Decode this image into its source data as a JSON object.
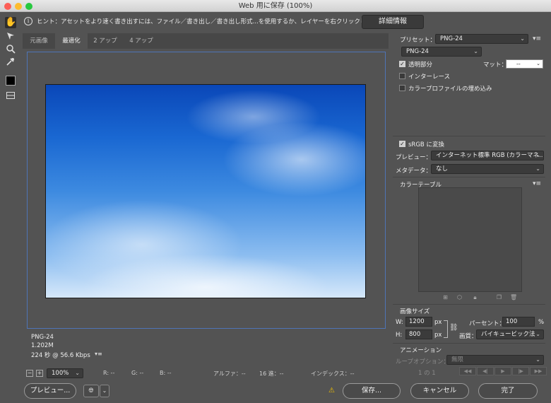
{
  "window": {
    "title": "Web 用に保存 (100%)"
  },
  "hint": {
    "text": "ヒント：アセットをより速く書き出すには、ファイル／書き出し／書き出し形式...を使用するか、レイヤーを右クリックして使用。",
    "details_button": "詳細情報"
  },
  "tools": [
    "hand-icon",
    "slice-select-icon",
    "zoom-icon",
    "eyedropper-icon",
    "color-swatch",
    "toggle-slices-icon"
  ],
  "tabs": [
    {
      "label": "元画像"
    },
    {
      "label": "最適化"
    },
    {
      "label": "2 アップ"
    },
    {
      "label": "4 アップ"
    }
  ],
  "image_info": {
    "format": "PNG-24",
    "size": "1.202M",
    "time": "224 秒 @ 56.6 Kbps"
  },
  "statusbar": {
    "zoom": "100%",
    "r": "R: --",
    "g": "G: --",
    "b": "B: --",
    "alpha": "アルファ：--",
    "hex": "16 進：--",
    "index": "インデックス：--"
  },
  "settings": {
    "preset_label": "プリセット：",
    "preset_value": "PNG-24",
    "format_value": "PNG-24",
    "transparency_label": "透明部分",
    "transparency_checked": true,
    "matte_label": "マット：",
    "matte_value": "--",
    "interlace_label": "インターレース",
    "embed_profile_label": "カラープロファイルの埋め込み",
    "srgb_label": "sRGB に変換",
    "preview_label": "プレビュー：",
    "preview_value": "インターネット標準 RGB (カラーマネ...",
    "metadata_label": "メタデータ：",
    "metadata_value": "なし",
    "color_table_label": "カラーテーブル"
  },
  "image_size": {
    "label": "画像サイズ",
    "w_label": "W:",
    "w_value": "1200",
    "h_label": "H:",
    "h_value": "800",
    "unit": "px",
    "percent_label": "パーセント：",
    "percent_value": "100",
    "percent_unit": "%",
    "quality_label": "画質：",
    "quality_value": "バイキュービック法"
  },
  "animation": {
    "label": "アニメーション",
    "loop_label": "ループオプション：",
    "loop_value": "無限",
    "frame_counter": "1 の 1"
  },
  "buttons": {
    "preview": "プレビュー...",
    "save": "保存...",
    "cancel": "キャンセル",
    "done": "完了"
  },
  "colors": {
    "canvas_border": "#4e74b6",
    "panel_bg": "#535353",
    "warning": "#f2c200"
  }
}
